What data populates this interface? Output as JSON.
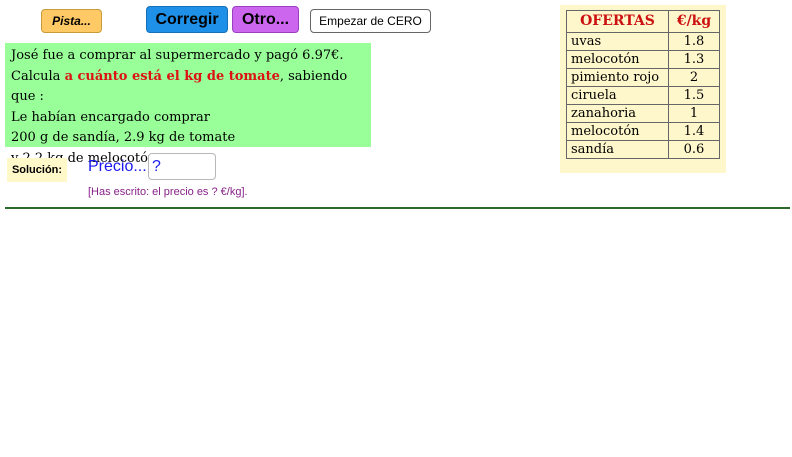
{
  "toolbar": {
    "pista_label": "Pista...",
    "corregir_label": "Corregir",
    "otro_label": "Otro...",
    "empezar_label": "Empezar de CERO"
  },
  "problem": {
    "line1": "José fue a comprar al supermercado y pagó 6.97€.",
    "line2_prefix": "Calcula ",
    "line2_highlight": "a cuánto está el kg de tomate",
    "line2_suffix": ", sabiendo que :",
    "line3": "Le habían encargado comprar",
    "line4": "200 g de sandía,  2.9 kg de tomate",
    "line5": "y 2.2 kg de melocotón."
  },
  "solution": {
    "label": "Solución:",
    "precio_label": "Precio...",
    "answer_value": "?",
    "feedback": "[Has escrito: el precio es ? €/kg]."
  },
  "offers": {
    "header_name": "OFERTAS",
    "header_price": "€/kg",
    "rows": [
      {
        "name": "uvas",
        "price": "1.8"
      },
      {
        "name": "melocotón",
        "price": "1.3"
      },
      {
        "name": "pimiento rojo",
        "price": "2"
      },
      {
        "name": "ciruela",
        "price": "1.5"
      },
      {
        "name": "zanahoria",
        "price": "1"
      },
      {
        "name": "melocotón",
        "price": "1.4"
      },
      {
        "name": "sandía",
        "price": "0.6"
      }
    ]
  }
}
